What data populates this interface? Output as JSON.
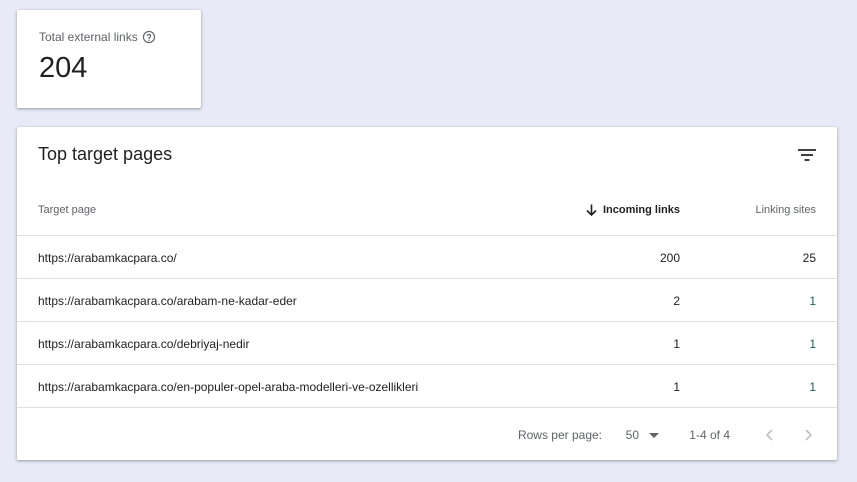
{
  "stat": {
    "label": "Total external links",
    "value": "204"
  },
  "table": {
    "title": "Top target pages",
    "headers": {
      "target_page": "Target page",
      "incoming_links": "Incoming links",
      "linking_sites": "Linking sites"
    },
    "rows": [
      {
        "url": "https://arabamkacpara.co/",
        "incoming": "200",
        "sites": "25"
      },
      {
        "url": "https://arabamkacpara.co/arabam-ne-kadar-eder",
        "incoming": "2",
        "sites": "1"
      },
      {
        "url": "https://arabamkacpara.co/debriyaj-nedir",
        "incoming": "1",
        "sites": "1"
      },
      {
        "url": "https://arabamkacpara.co/en-populer-opel-araba-modelleri-ve-ozellikleri",
        "incoming": "1",
        "sites": "1"
      }
    ],
    "pagination": {
      "rows_per_page_label": "Rows per page:",
      "rows_per_page_value": "50",
      "range": "1-4 of 4"
    }
  },
  "icons": {
    "help": "help-icon",
    "filter": "filter-icon",
    "sort": "arrow-down-icon",
    "dropdown": "caret-down-icon",
    "prev": "chevron-left-icon",
    "next": "chevron-right-icon"
  },
  "colors": {
    "background": "#e8ebf7",
    "text": "#202124",
    "muted": "#5f6368",
    "accent_value": "#1b5e5c"
  }
}
